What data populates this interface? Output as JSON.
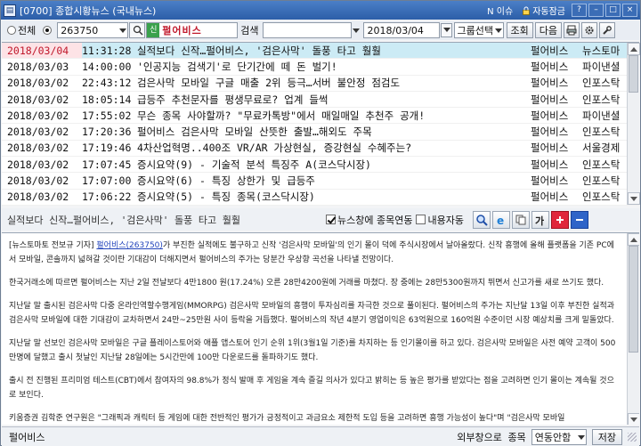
{
  "window": {
    "title": "[0700] 종합시황뉴스 (국내뉴스)",
    "badge_new": "N 이슈",
    "auto_lock": "자동잠금",
    "controls": [
      "?",
      "–",
      "□",
      "×"
    ]
  },
  "toolbar": {
    "radio_all": "전체",
    "stock_code": "263750",
    "badge_shin": "신",
    "stock_name": "펄어비스",
    "search_label": "검색",
    "search_value": "",
    "date": "2018/03/04",
    "group_select": "그룹선택",
    "query_button": "조회",
    "next_button": "다음"
  },
  "news": [
    {
      "date": "2018/03/04",
      "time": "11:31:28",
      "headline": "실적보다 신작…펄어비스, '검은사막' 돌풍 타고 훨훨",
      "stock": "펄어비스",
      "provider": "뉴스토마",
      "selected": true
    },
    {
      "date": "2018/03/03",
      "time": "14:00:00",
      "headline": "'인공지능 검색기'로 단기간에 떼 돈 벌기!",
      "stock": "펄어비스",
      "provider": "파이낸셜"
    },
    {
      "date": "2018/03/02",
      "time": "22:43:12",
      "headline": "검은사막 모바일 구글 매출 2위 등극…서버 불안정 점검도",
      "stock": "펄어비스",
      "provider": "인포스탁"
    },
    {
      "date": "2018/03/02",
      "time": "18:05:14",
      "headline": "급등주 추천문자를 평생무료로? 업계 들썩",
      "stock": "펄어비스",
      "provider": "인포스탁"
    },
    {
      "date": "2018/03/02",
      "time": "17:55:02",
      "headline": "무슨 종목 사야할까? \"무료카톡방\"에서 매일매일 추천주 공개!",
      "stock": "펄어비스",
      "provider": "파이낸셜"
    },
    {
      "date": "2018/03/02",
      "time": "17:20:36",
      "headline": "펄어비스 검은사막 모바일 산뜻한 출발…해외도 주목",
      "stock": "펄어비스",
      "provider": "인포스탁"
    },
    {
      "date": "2018/03/02",
      "time": "17:19:46",
      "headline": "4차산업혁명..400조 VR/AR 가상현실, 증강현실 수혜주는?",
      "stock": "펄어비스",
      "provider": "서울경제"
    },
    {
      "date": "2018/03/02",
      "time": "17:07:45",
      "headline": "증시요약(9) - 기술적 분석 특징주 A(코스닥시장)",
      "stock": "펄어비스",
      "provider": "인포스탁"
    },
    {
      "date": "2018/03/02",
      "time": "17:07:00",
      "headline": "증시요약(6) - 특징 상한가 및 급등주",
      "stock": "펄어비스",
      "provider": "인포스탁"
    },
    {
      "date": "2018/03/02",
      "time": "17:06:22",
      "headline": "증시요약(5) - 특징 종목(코스닥시장)",
      "stock": "펄어비스",
      "provider": "인포스탁"
    }
  ],
  "detail": {
    "title": "실적보다 신작…펄어비스, '검은사막' 돌풍 타고 훨훨",
    "check_link": "뉴스창에 종목연동",
    "check_auto": "내용자동"
  },
  "article": {
    "p1_prefix": "[뉴스토마토 전보규 기자] ",
    "p1_link": "펄어비스(263750)",
    "p1_rest": "가 부진한 실적에도 불구하고 신작 '검은사막 모바일'의 인기 몰이 덕에 주식시장에서 날아올랐다. 신작 흥행에 올해 플랫폼을 기존 PC에서 모바일, 콘솔까지 넓혀갈 것이란 기대감이 더해지면서 펄어비스의 주가는 당분간 우상향 곡선을 나타낼 전망이다.",
    "p2": "한국거래소에 따르면 펄어비스는 지난 2일 전날보다 4만1800 원(17.24%) 오른 28만4200원에 거래를 마쳤다. 장 중에는 28만5300원까지 뛰면서 신고가를 새로 쓰기도 했다.",
    "p3": "지난달 말 출시된 검은사막 다중 온라인역할수행게임(MMORPG) 검은사막 모바일의 흥행이 투자심리를 자극한 것으로 풀이된다. 펄어비스의 주가는 지난달 13일 이후 부진한 실적과 검은사막 모바일에 대한 기대감이 교차하면서 24만~25만원 사이 등락을 거듭했다. 펄어비스의 작년 4분기 영업이익은 63억원으로 160억원 수준이던 시장 예상치를 크게 밑돌았다.",
    "p4": "지난달 말 선보인 검은사막 모바일은 구글 플레이스토어와 애플 앱스토어 인기 순위 1위(3월1일 기준)를 차지하는 등 인기몰이를 하고 있다. 검은사막 모바일은 사전 예약 고객이 500 만명에 달했고 출시 첫날인 지난달 28일에는 5시간만에 100만 다운로드를 돌파하기도 했다.",
    "p5": "출시 전 진행된 프리미엄 테스트(CBT)에서 참여자의 98.8%가 정식 발매 후 게임을 계속 즐길 의사가 있다고 밝히는 등 높은 평가를 받았다는 점을 고려하면 인기 몰이는 계속될 것으로 보인다.",
    "p6": "키움증권 김학준 연구원은 \"그래픽과 캐릭터 등 게임에 대한 전반적인 평가가 긍정적이고 과금요소 제한적 도입 등을 고려하면 흥행 가능성이 높다\"며 \"검은사막 모바일"
  },
  "status": {
    "stock_name": "펄어비스",
    "order_label": "외부창으로 종목",
    "order_select": "연동안함",
    "save_button": "저장"
  }
}
